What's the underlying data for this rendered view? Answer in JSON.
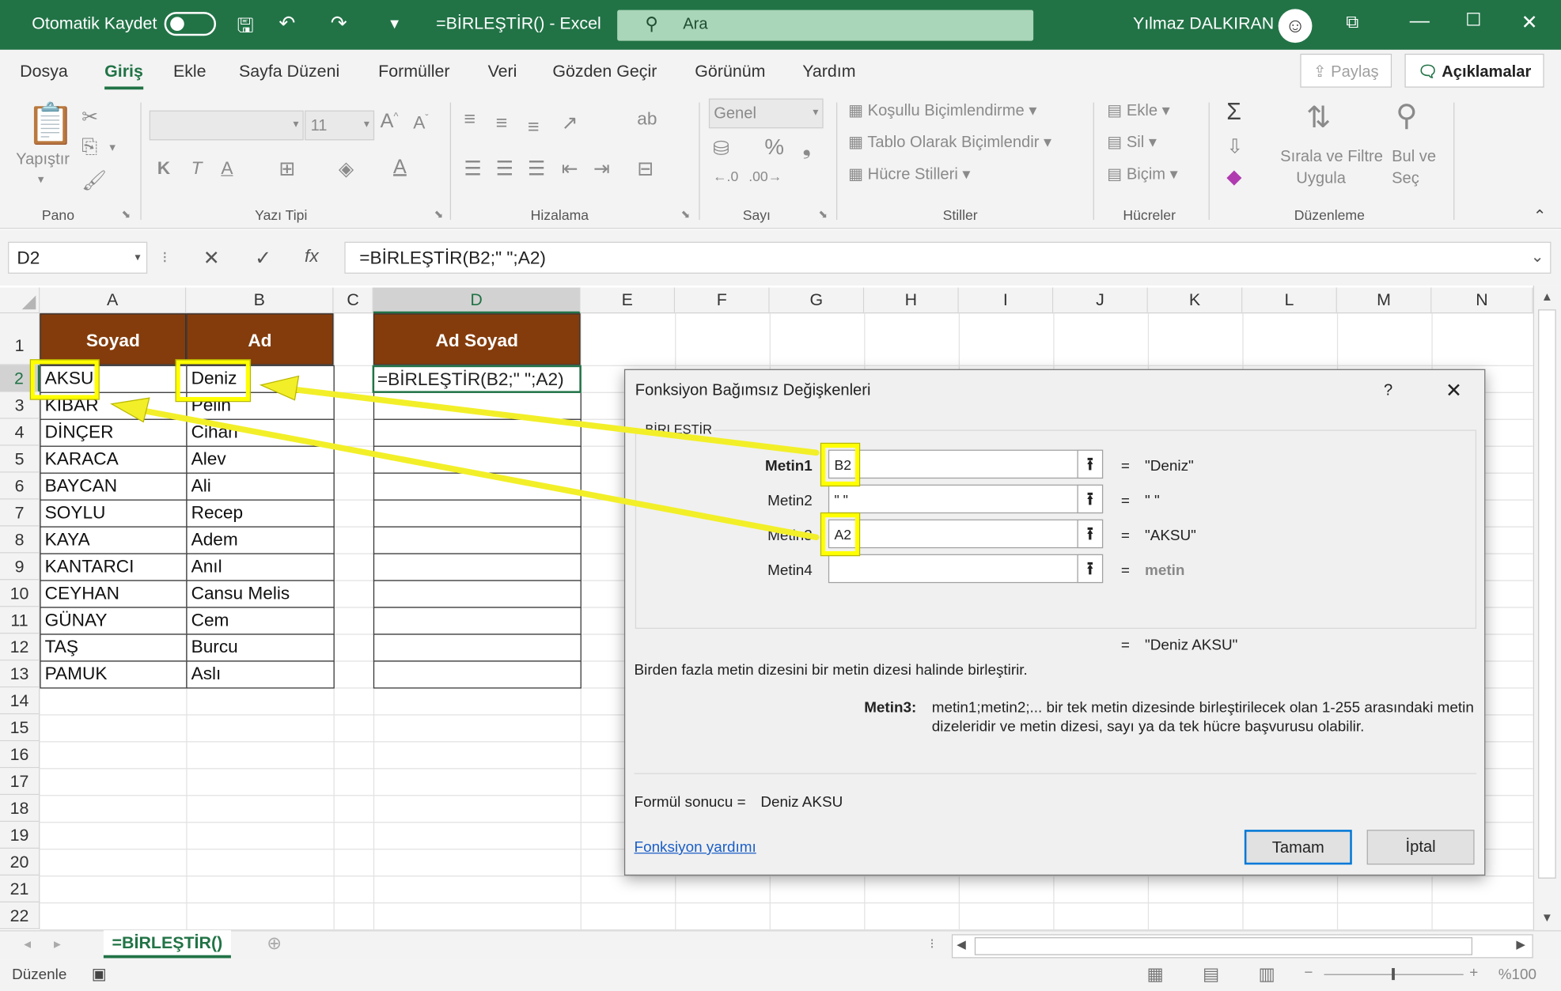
{
  "titlebar": {
    "autosave": "Otomatik Kaydet",
    "doc_title": "=BİRLEŞTİR()  -  Excel",
    "search_placeholder": "Ara",
    "user": "Yılmaz DALKIRAN"
  },
  "menu": {
    "items": [
      "Dosya",
      "Giriş",
      "Ekle",
      "Sayfa Düzeni",
      "Formüller",
      "Veri",
      "Gözden Geçir",
      "Görünüm",
      "Yardım"
    ],
    "share": "Paylaş",
    "comments": "Açıklamalar"
  },
  "ribbon": {
    "paste": "Yapıştır",
    "font_size": "11",
    "number_format": "Genel",
    "cond_format": "Koşullu Biçimlendirme",
    "table_format": "Tablo Olarak Biçimlendir",
    "cell_styles": "Hücre Stilleri",
    "insert": "Ekle",
    "delete": "Sil",
    "format": "Biçim",
    "sort_filter_1": "Sırala ve Filtre",
    "sort_filter_2": "Uygula",
    "find_1": "Bul ve",
    "find_2": "Seç",
    "groups": [
      "Pano",
      "Yazı Tipi",
      "Hizalama",
      "Sayı",
      "Stiller",
      "Hücreler",
      "Düzenleme"
    ]
  },
  "formula_bar": {
    "name_box": "D2",
    "formula": "=BİRLEŞTİR(B2;\" \";A2)"
  },
  "sheet": {
    "columns": [
      "A",
      "B",
      "C",
      "D",
      "E",
      "F",
      "G",
      "H",
      "I",
      "J",
      "K",
      "L",
      "M",
      "N"
    ],
    "rows": [
      "1",
      "2",
      "3",
      "4",
      "5",
      "6",
      "7",
      "8",
      "9",
      "10",
      "11",
      "12",
      "13",
      "14",
      "15",
      "16",
      "17",
      "18",
      "19",
      "20",
      "21",
      "22"
    ],
    "header": {
      "soyad": "Soyad",
      "ad": "Ad",
      "ad_soyad": "Ad Soyad"
    },
    "soyad": [
      "AKSU",
      "KIBAR",
      "DİNÇER",
      "KARACA",
      "BAYCAN",
      "SOYLU",
      "KAYA",
      "KANTARCI",
      "CEYHAN",
      "GÜNAY",
      "TAŞ",
      "PAMUK"
    ],
    "ad": [
      "Deniz",
      "Pelin",
      "Cihan",
      "Alev",
      "Ali",
      "Recep",
      "Adem",
      "Anıl",
      "Cansu Melis",
      "Cem",
      "Burcu",
      "Aslı"
    ],
    "d2": "=BİRLEŞTİR(B2;\" \";A2)"
  },
  "dialog": {
    "title": "Fonksiyon Bağımsız Değişkenleri",
    "help": "?",
    "func_name": "BİRLEŞTİR",
    "args": [
      {
        "label": "Metin1",
        "value": "B2",
        "result": "\"Deniz\""
      },
      {
        "label": "Metin2",
        "value": "\" \"",
        "result": "\" \""
      },
      {
        "label": "Metin3",
        "value": "A2",
        "result": "\"AKSU\""
      },
      {
        "label": "Metin4",
        "value": "",
        "result": "metin"
      }
    ],
    "eq": "=",
    "total_result": "\"Deniz AKSU\"",
    "description": "Birden fazla metin dizesini bir metin dizesi halinde birleştirir.",
    "arg_help_label": "Metin3:",
    "arg_help_1": "metin1;metin2;... bir tek metin dizesinde birleştirilecek olan 1-255 arasındaki metin",
    "arg_help_2": "dizeleridir ve metin dizesi, sayı ya da tek hücre başvurusu olabilir.",
    "formula_result_label": "Formül sonucu =",
    "formula_result": "Deniz AKSU",
    "help_link": "Fonksiyon yardımı",
    "ok": "Tamam",
    "cancel": "İptal"
  },
  "tabs": {
    "sheet_name": "=BİRLEŞTİR()"
  },
  "status": {
    "mode": "Düzenle",
    "zoom": "%100"
  },
  "colors": {
    "excel_green": "#217346",
    "header_brown": "#843c0c",
    "highlight": "#ffff00"
  }
}
